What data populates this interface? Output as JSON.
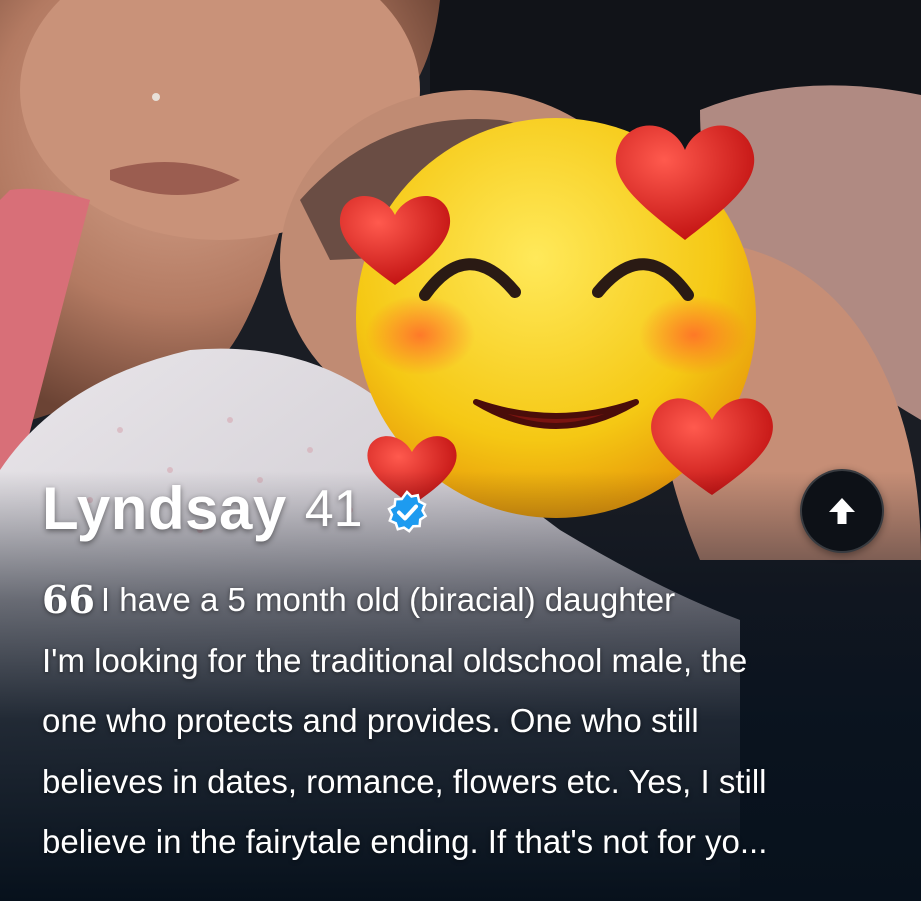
{
  "profile": {
    "name": "Lyndsay",
    "age": "41",
    "verified": true,
    "bio_lines": [
      "I have a 5 month old (biracial) daughter",
      "I'm looking for the traditional oldschool male, the",
      "one who protects and provides. One who still",
      "believes in dates, romance, flowers etc. Yes, I still",
      "believe in the fairytale ending. If that's not for yo..."
    ],
    "quote_mark": "66"
  },
  "icons": {
    "verified": "verified-check-badge-icon",
    "expand": "arrow-up-icon",
    "emoji": "smiling-face-with-hearts-emoji"
  },
  "colors": {
    "verified_blue": "#1d9bf0",
    "button_bg": "#0d1117",
    "emoji_yellow": "#f7d21a",
    "heart_red": "#e3231f"
  }
}
